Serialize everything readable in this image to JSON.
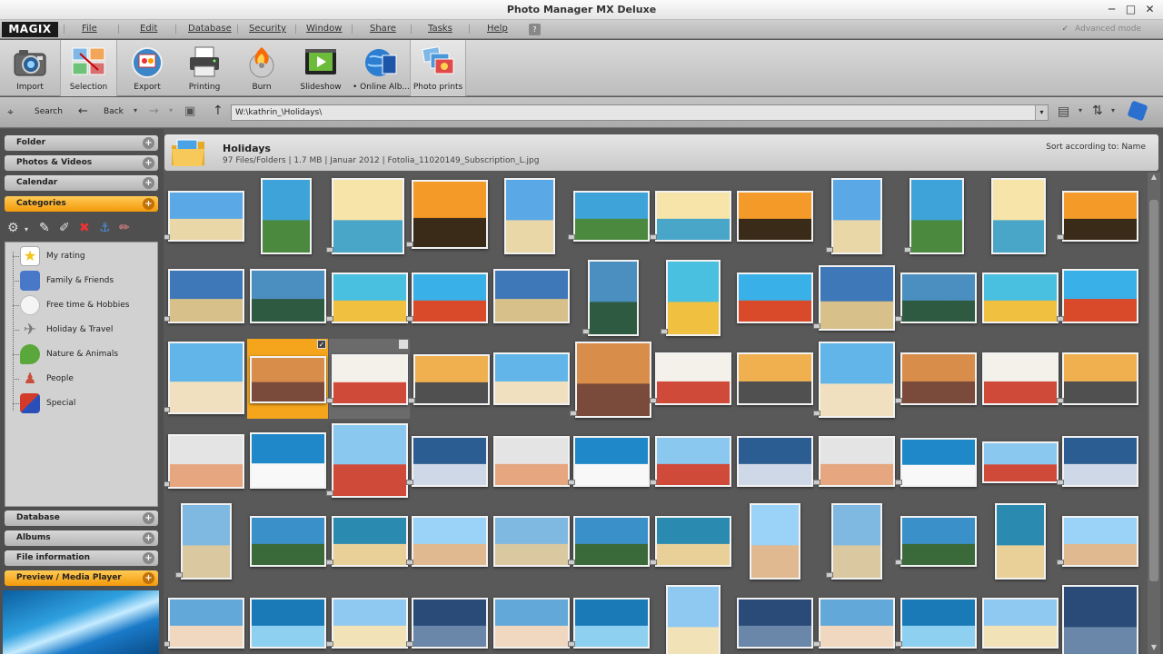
{
  "window": {
    "title": "Photo Manager MX Deluxe",
    "min": "─",
    "max": "□",
    "close": "✕"
  },
  "menubar": {
    "logo": "MAGIX",
    "items": [
      "File",
      "Edit",
      "Database",
      "Security",
      "Window",
      "Share",
      "Tasks",
      "Help"
    ],
    "help_glyph": "?",
    "advanced_check": "✓",
    "advanced_mode": "Advanced mode"
  },
  "toolbar": {
    "buttons": [
      {
        "label": "Import",
        "icon": "camera-icon"
      },
      {
        "label": "Selection",
        "icon": "selection-icon"
      },
      {
        "label": "Export",
        "icon": "export-icon"
      },
      {
        "label": "Printing",
        "icon": "printer-icon"
      },
      {
        "label": "Burn",
        "icon": "burn-disc-icon"
      },
      {
        "label": "Slideshow",
        "icon": "slideshow-icon"
      },
      {
        "label": "• Online Alb...",
        "icon": "online-album-icon"
      },
      {
        "label": "Photo prints",
        "icon": "photo-prints-icon"
      }
    ]
  },
  "navbar": {
    "search": "Search",
    "back": "Back",
    "path": "W:\\kathrin_\\Holidays\\"
  },
  "sidebar": {
    "sections_top": [
      {
        "label": "Folder",
        "active": false
      },
      {
        "label": "Photos & Videos",
        "active": false
      },
      {
        "label": "Calendar",
        "active": false
      },
      {
        "label": "Categories",
        "active": true
      }
    ],
    "plus": "+",
    "categories": [
      {
        "label": "My rating",
        "icon": "star-icon",
        "color": "#f6d33c"
      },
      {
        "label": "Family & Friends",
        "icon": "family-icon",
        "color": "#4a78c8"
      },
      {
        "label": "Free time & Hobbies",
        "icon": "snowman-icon",
        "color": "#e8e8e8"
      },
      {
        "label": "Holiday & Travel",
        "icon": "airplane-icon",
        "color": "#c9c9c9"
      },
      {
        "label": "Nature & Animals",
        "icon": "parrot-icon",
        "color": "#5aa83c"
      },
      {
        "label": "People",
        "icon": "person-icon",
        "color": "#d7a86b"
      },
      {
        "label": "Special",
        "icon": "special-icon",
        "color": "#d43a2a"
      }
    ],
    "sections_bottom": [
      {
        "label": "Database",
        "active": false
      },
      {
        "label": "Albums",
        "active": false
      },
      {
        "label": "File information",
        "active": false
      },
      {
        "label": "Preview / Media Player",
        "active": true
      }
    ]
  },
  "folder_header": {
    "title": "Holidays",
    "info": "97 Files/Folders | 1.7 MB | Januar 2012 | Fotolia_11020149_Subscription_L.jpg",
    "sort": "Sort according to: Name"
  },
  "colors": {
    "accent": "#f4a51c",
    "panel": "#4f4f4f",
    "content_bg": "#595959"
  }
}
